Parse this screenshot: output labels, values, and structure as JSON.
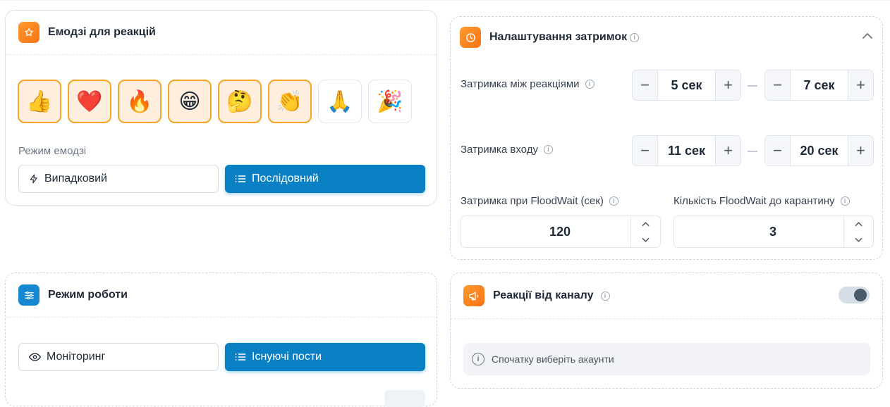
{
  "emoji_card": {
    "title": "Емодзі для реакцій",
    "header_icon": "star-icon",
    "emojis": [
      {
        "char": "👍",
        "name": "thumbs-up",
        "selected": true
      },
      {
        "char": "❤️",
        "name": "heart",
        "selected": true
      },
      {
        "char": "🔥",
        "name": "fire",
        "selected": true
      },
      {
        "char": "😁",
        "name": "grin",
        "selected": true
      },
      {
        "char": "🤔",
        "name": "thinking",
        "selected": true
      },
      {
        "char": "👏",
        "name": "clapping",
        "selected": true
      },
      {
        "char": "🙏",
        "name": "folded-hands",
        "selected": false
      },
      {
        "char": "🎉",
        "name": "party-popper",
        "selected": false
      }
    ],
    "mode_label": "Режим емодзі",
    "mode_random": "Випадковий",
    "mode_sequential": "Послідовний",
    "active_mode": "sequential"
  },
  "work_mode_card": {
    "title": "Режим роботи",
    "header_icon": "sliders-icon",
    "monitoring": "Моніторинг",
    "existing_posts": "Існуючі пости",
    "active_mode": "existing_posts"
  },
  "delay_card": {
    "title": "Налаштування затримок",
    "header_icon": "clock-icon",
    "reaction_delay_label": "Затримка між реакціями",
    "reaction_delay_min": "5 сек",
    "reaction_delay_max": "7 сек",
    "join_delay_label": "Затримка входу",
    "join_delay_min": "11 сек",
    "join_delay_max": "20 сек",
    "floodwait_delay_label": "Затримка при FloodWait (сек)",
    "floodwait_delay_value": "120",
    "floodwait_count_label": "Кількість FloodWait до карантину",
    "floodwait_count_value": "3"
  },
  "channel_card": {
    "title": "Реакції від каналу",
    "header_icon": "megaphone-icon",
    "toggle_on": true,
    "notice": "Спочатку виберіть акаунти"
  },
  "colors": {
    "accent_blue": "#0a80c4",
    "accent_orange": "#f97316",
    "selected_border": "#f5a524"
  }
}
